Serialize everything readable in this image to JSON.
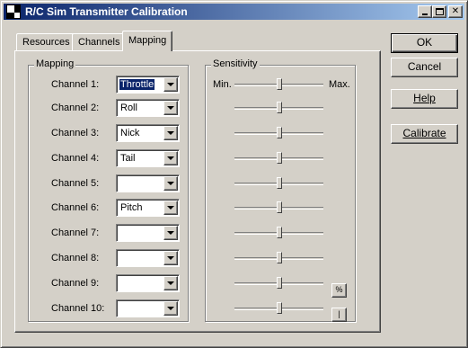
{
  "window": {
    "title": "R/C Sim Transmitter Calibration",
    "icon": "checkered-icon"
  },
  "tabs": [
    {
      "label": "Resources",
      "active": false
    },
    {
      "label": "Channels",
      "active": false
    },
    {
      "label": "Mapping",
      "active": true
    }
  ],
  "mapping": {
    "group_title": "Mapping",
    "channels": [
      {
        "label": "Channel 1:",
        "value": "Throttle"
      },
      {
        "label": "Channel 2:",
        "value": "Roll"
      },
      {
        "label": "Channel 3:",
        "value": "Nick"
      },
      {
        "label": "Channel 4:",
        "value": "Tail"
      },
      {
        "label": "Channel 5:",
        "value": ""
      },
      {
        "label": "Channel 6:",
        "value": "Pitch"
      },
      {
        "label": "Channel 7:",
        "value": ""
      },
      {
        "label": "Channel 8:",
        "value": ""
      },
      {
        "label": "Channel 9:",
        "value": ""
      },
      {
        "label": "Channel 10:",
        "value": ""
      }
    ]
  },
  "sensitivity": {
    "group_title": "Sensitivity",
    "min_label": "Min.",
    "max_label": "Max.",
    "levels": [
      0.5,
      0.5,
      0.5,
      0.5,
      0.5,
      0.5,
      0.5,
      0.5,
      0.5,
      0.5
    ],
    "percent_button": "%",
    "bar_button": "|"
  },
  "buttons": {
    "ok": "OK",
    "cancel": "Cancel",
    "help": "Help",
    "calibrate": "Calibrate"
  }
}
